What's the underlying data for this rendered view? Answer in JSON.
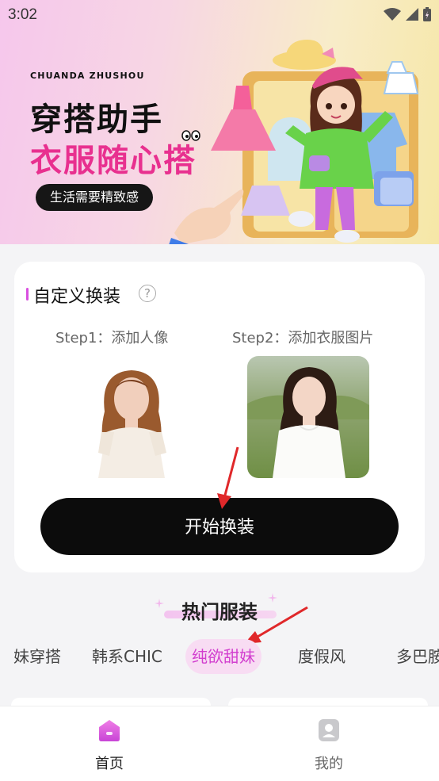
{
  "status": {
    "time": "3:02"
  },
  "banner": {
    "brand_en": "CHUANDA ZHUSHOU",
    "title_line1": "穿搭助手",
    "title_line2": "衣服随心搭",
    "tagline": "生活需要精致感"
  },
  "custom": {
    "title": "自定义换装",
    "help_icon": "question-icon",
    "step1_label": "Step1：添加人像",
    "step2_label": "Step2：添加衣服图片",
    "start_button": "开始换装"
  },
  "hot": {
    "title": "热门服装",
    "tabs": [
      {
        "label": "妹穿搭",
        "active": false
      },
      {
        "label": "韩系CHIC",
        "active": false
      },
      {
        "label": "纯欲甜妹",
        "active": true
      },
      {
        "label": "度假风",
        "active": false
      },
      {
        "label": "多巴胺",
        "active": false
      }
    ]
  },
  "nav": {
    "items": [
      {
        "label": "首页",
        "icon": "home-icon",
        "active": true
      },
      {
        "label": "我的",
        "icon": "profile-icon",
        "active": false
      }
    ]
  },
  "colors": {
    "accent": "#d23fcf",
    "brand_pink": "#e8308f",
    "button_bg": "#0c0c0c",
    "arrow": "#e0282a"
  }
}
